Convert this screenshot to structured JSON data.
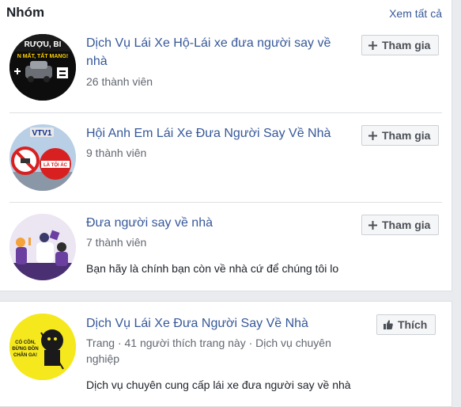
{
  "section": {
    "title": "Nhóm",
    "see_all": "Xem tất cả"
  },
  "groups": [
    {
      "name_line1": "Dịch Vụ Lái Xe Hộ-Lái xe đưa người say về",
      "name_line2": "nhà",
      "members": "26 thành viên",
      "join_label": "Tham gia",
      "avatar_text_top": "RƯỢU, BI",
      "avatar_text_bottom": "N MẤT, TẤT MANG!"
    },
    {
      "name_line1": "Hội Anh Em Lái Xe Đưa Người Say Về Nhà",
      "members": "9 thành viên",
      "join_label": "Tham gia",
      "avatar_badge": "VTV1",
      "avatar_sign": "LÀ TỘI ÁC"
    },
    {
      "name_line1": "Đưa người say về nhà",
      "members": "7 thành viên",
      "description": "Bạn hãy là chính bạn còn về nhà cứ để chúng tôi lo",
      "join_label": "Tham gia"
    }
  ],
  "page": {
    "name": "Dịch Vụ Lái Xe Đưa Người Say Về Nhà",
    "meta_line1": "Trang · 41 người thích trang này · Dịch vụ chuyên",
    "meta_line2": "nghiệp",
    "description": "Dịch vụ chuyên cung cấp lái xe đưa người say về nhà",
    "like_label": "Thích",
    "avatar_text": "CÓ CỒN, ĐỪNG ĐỒN CHÂN GA!"
  },
  "colors": {
    "link": "#365899",
    "page_avatar_bg": "#f5e81c"
  }
}
